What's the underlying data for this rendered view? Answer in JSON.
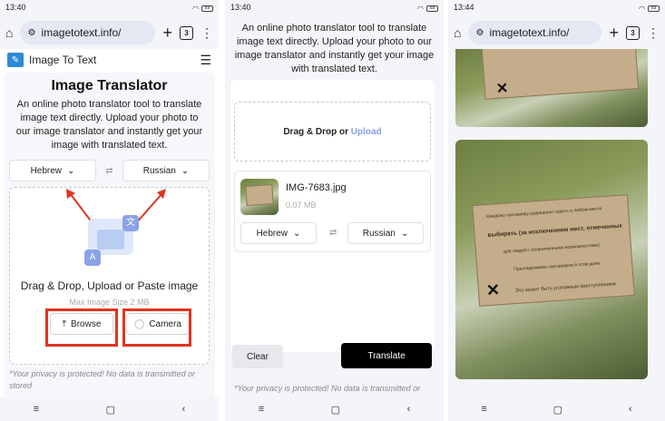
{
  "screens": [
    {
      "status": {
        "time": "13:40",
        "battery": "69"
      },
      "browser": {
        "url": "imagetotext.info/",
        "tab_count": "3"
      },
      "site": {
        "name": "Image To Text"
      },
      "page": {
        "title": "Image Translator",
        "description": "An online photo translator tool to translate image text directly. Upload your photo to our image translator and instantly get your image with translated text.",
        "source_lang": "Hebrew",
        "target_lang": "Russian",
        "drop_text": "Drag & Drop, Upload or Paste image",
        "max_size": "Max Image Size 2 MB",
        "browse_label": "Browse",
        "camera_label": "Camera",
        "privacy": "*Your privacy is protected! No data is transmitted or stored"
      }
    },
    {
      "status": {
        "time": "13:40",
        "battery": "69"
      },
      "page": {
        "description": "An online photo translator tool to translate image text directly. Upload your photo to our image translator and instantly get your image with translated text.",
        "drop_text": "Drag & Drop or ",
        "upload_link": "Upload",
        "file_name": "IMG-7683.jpg",
        "file_size": "0.07 MB",
        "source_lang": "Hebrew",
        "target_lang": "Russian",
        "clear_label": "Clear",
        "translate_label": "Translate",
        "privacy": "*Your privacy is protected! No data is transmitted or"
      }
    },
    {
      "status": {
        "time": "13:44",
        "battery": "69"
      },
      "browser": {
        "url": "imagetotext.info/",
        "tab_count": "3"
      },
      "result_sign": {
        "line1": "Каждому пассажиру разрешено сидеть в любом месте",
        "line2": "выбирать (за исключением мест, отмеченных",
        "line3": "для людей с ограниченными возможностями)",
        "line4": "Преследование пассажиров в этом доме",
        "line5": "Это может быть уголовным преступлением."
      }
    }
  ],
  "colors": {
    "accent_blue": "#8aa3e6",
    "highlight_red": "#e0341f",
    "translate_bg": "#000000"
  }
}
